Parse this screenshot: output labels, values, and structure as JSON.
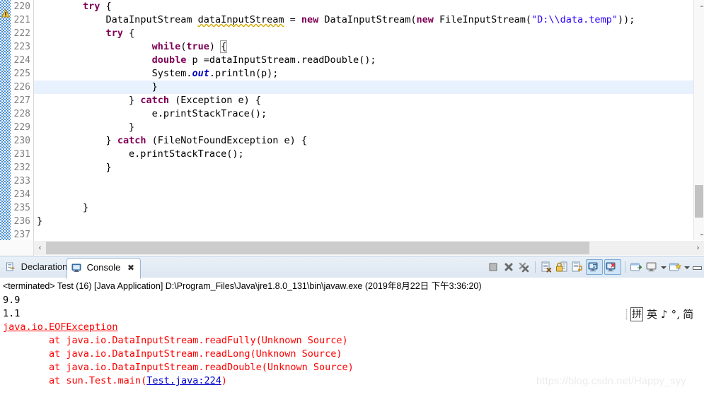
{
  "editor": {
    "first_line": 220,
    "highlighted_line": 226,
    "warning_line": 221,
    "warning_icon": "warning-triangle-icon",
    "lines": [
      {
        "no": "220",
        "indent": 8,
        "tokens": [
          {
            "t": "try",
            "c": "kw"
          },
          {
            "t": " {",
            "c": ""
          }
        ]
      },
      {
        "no": "221",
        "indent": 12,
        "tokens": [
          {
            "t": "DataInputStream ",
            "c": ""
          },
          {
            "t": "dataInputStream",
            "c": "warnu"
          },
          {
            "t": " = ",
            "c": ""
          },
          {
            "t": "new",
            "c": "kw"
          },
          {
            "t": " DataInputStream(",
            "c": ""
          },
          {
            "t": "new",
            "c": "kw"
          },
          {
            "t": " FileInputStream(",
            "c": ""
          },
          {
            "t": "\"D:\\\\data.temp\"",
            "c": "str"
          },
          {
            "t": "));",
            "c": ""
          }
        ]
      },
      {
        "no": "222",
        "indent": 12,
        "tokens": [
          {
            "t": "try",
            "c": "kw"
          },
          {
            "t": " {",
            "c": ""
          }
        ]
      },
      {
        "no": "223",
        "indent": 20,
        "tokens": [
          {
            "t": "while",
            "c": "kw"
          },
          {
            "t": "(",
            "c": ""
          },
          {
            "t": "true",
            "c": "kw"
          },
          {
            "t": ") ",
            "c": ""
          },
          {
            "t": "{",
            "c": "brmatch"
          }
        ]
      },
      {
        "no": "224",
        "indent": 20,
        "tokens": [
          {
            "t": "double",
            "c": "kw"
          },
          {
            "t": " p =dataInputStream.readDouble();",
            "c": ""
          }
        ]
      },
      {
        "no": "225",
        "indent": 20,
        "tokens": [
          {
            "t": "System.",
            "c": ""
          },
          {
            "t": "out",
            "c": "fld"
          },
          {
            "t": ".println(p);",
            "c": ""
          }
        ]
      },
      {
        "no": "226",
        "indent": 20,
        "tokens": [
          {
            "t": "}",
            "c": ""
          }
        ]
      },
      {
        "no": "227",
        "indent": 16,
        "tokens": [
          {
            "t": "} ",
            "c": ""
          },
          {
            "t": "catch",
            "c": "kw"
          },
          {
            "t": " (Exception e) {",
            "c": ""
          }
        ]
      },
      {
        "no": "228",
        "indent": 20,
        "tokens": [
          {
            "t": "e.printStackTrace();",
            "c": ""
          }
        ]
      },
      {
        "no": "229",
        "indent": 16,
        "tokens": [
          {
            "t": "}",
            "c": ""
          }
        ]
      },
      {
        "no": "230",
        "indent": 12,
        "tokens": [
          {
            "t": "} ",
            "c": ""
          },
          {
            "t": "catch",
            "c": "kw"
          },
          {
            "t": " (FileNotFoundException e) {",
            "c": ""
          }
        ]
      },
      {
        "no": "231",
        "indent": 16,
        "tokens": [
          {
            "t": "e.printStackTrace();",
            "c": ""
          }
        ]
      },
      {
        "no": "232",
        "indent": 12,
        "tokens": [
          {
            "t": "}",
            "c": ""
          }
        ]
      },
      {
        "no": "233",
        "indent": 0,
        "tokens": []
      },
      {
        "no": "234",
        "indent": 0,
        "tokens": []
      },
      {
        "no": "235",
        "indent": 8,
        "tokens": [
          {
            "t": "}",
            "c": ""
          }
        ]
      },
      {
        "no": "236",
        "indent": 0,
        "tokens": [
          {
            "t": "}",
            "c": ""
          }
        ]
      },
      {
        "no": "237",
        "indent": 0,
        "tokens": []
      }
    ],
    "h_scroll": {
      "left_arrow": "‹",
      "right_arrow": "›"
    },
    "v_scroll": {
      "right_arrow": "›"
    }
  },
  "console_view": {
    "tabs": [
      {
        "label": "Declaration",
        "icon": "declaration-view-icon",
        "active": false,
        "closable": false
      },
      {
        "label": "Console",
        "icon": "console-view-icon",
        "active": true,
        "closable": true,
        "close_glyph": "✖"
      }
    ],
    "toolbar": [
      {
        "name": "terminate-button",
        "icon": "stop-square-icon"
      },
      {
        "name": "remove-launch-button",
        "icon": "x-gray-icon"
      },
      {
        "name": "remove-all-launches-button",
        "icon": "xx-gray-icon"
      },
      {
        "name": "separator-1",
        "icon": "separator"
      },
      {
        "name": "clear-console-button",
        "icon": "clear-console-icon"
      },
      {
        "name": "scroll-lock-button",
        "icon": "lock-scroll-icon"
      },
      {
        "name": "word-wrap-button",
        "icon": "word-wrap-icon"
      },
      {
        "name": "show-console-on-output-button",
        "icon": "console-out-icon",
        "selected": true
      },
      {
        "name": "show-console-on-error-button",
        "icon": "console-err-icon",
        "selected": true
      },
      {
        "name": "separator-2",
        "icon": "separator"
      },
      {
        "name": "pin-console-button",
        "icon": "pin-console-icon"
      },
      {
        "name": "display-selected-console-button",
        "icon": "display-console-icon"
      },
      {
        "name": "display-selected-console-menu",
        "icon": "chevron-down-icon"
      },
      {
        "name": "open-console-button",
        "icon": "new-console-icon"
      },
      {
        "name": "open-console-menu",
        "icon": "chevron-down-icon"
      },
      {
        "name": "minimize-button",
        "icon": "minimize-icon"
      }
    ],
    "process_line": "<terminated> Test (16) [Java Application] D:\\Program_Files\\Java\\jre1.8.0_131\\bin\\javaw.exe (2019年8月22日 下午3:36:20)",
    "output": [
      {
        "text": "9.9",
        "style": "out",
        "indent": 0
      },
      {
        "text": "1.1",
        "style": "out",
        "indent": 0
      },
      {
        "text": "java.io.EOFException",
        "style": "err-link",
        "indent": 0
      },
      {
        "text": "\tat java.io.DataInputStream.readFully(Unknown Source)",
        "style": "err",
        "indent": 0
      },
      {
        "text": "\tat java.io.DataInputStream.readLong(Unknown Source)",
        "style": "err",
        "indent": 0
      },
      {
        "text": "\tat java.io.DataInputStream.readDouble(Unknown Source)",
        "style": "err",
        "indent": 0
      },
      {
        "text": "\tat sun.Test.main(",
        "style": "err-with-link",
        "indent": 0,
        "link": "Test.java:224",
        "suffix": ")"
      }
    ]
  },
  "ime_bar": {
    "items": [
      {
        "glyph": "拼",
        "boxed": true,
        "name": "ime-mode-pinyin"
      },
      {
        "glyph": "英",
        "boxed": false,
        "name": "ime-language-english"
      },
      {
        "glyph": "♪",
        "boxed": false,
        "name": "ime-soft-keyboard"
      },
      {
        "glyph": "°⸲",
        "boxed": false,
        "name": "ime-punctuation"
      },
      {
        "glyph": "简",
        "boxed": false,
        "name": "ime-simplified"
      }
    ]
  },
  "watermark": {
    "text": "https://blog.csdn.net/Happy_syy"
  },
  "colors": {
    "keyword": "#7f0055",
    "string": "#2a00ff",
    "field": "#0000c0",
    "error": "#ff0000",
    "link": "#0000cc",
    "highlight_line": "#e8f2fe",
    "marker_bar": "#4a90d9"
  }
}
